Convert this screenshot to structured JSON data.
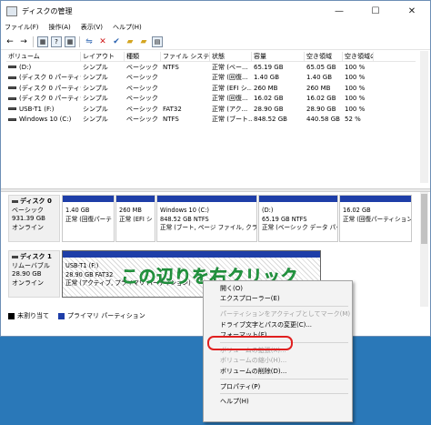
{
  "window": {
    "title": "ディスクの管理",
    "controls": {
      "minimize": "—",
      "maximize": "☐",
      "close": "✕"
    }
  },
  "menu": [
    "ファイル(F)",
    "操作(A)",
    "表示(V)",
    "ヘルプ(H)"
  ],
  "toolbar_icons": [
    "back-arrow-icon",
    "forward-arrow-icon",
    "grid-icon",
    "help-icon",
    "grid-icon-2",
    "connect-icon",
    "delete-icon",
    "check-icon",
    "folder-icon",
    "folder-icon-2",
    "properties-icon"
  ],
  "volume_table": {
    "columns": [
      "ボリューム",
      "レイアウト",
      "種類",
      "ファイル システム",
      "状態",
      "容量",
      "空き領域",
      "空き領域の割..."
    ],
    "rows": [
      [
        "(D:)",
        "シンプル",
        "ベーシック",
        "NTFS",
        "正常 (ベー...",
        "65.19 GB",
        "65.05 GB",
        "100 %"
      ],
      [
        "(ディスク 0 パーティシ...",
        "シンプル",
        "ベーシック",
        "",
        "正常 (回復...",
        "1.40 GB",
        "1.40 GB",
        "100 %"
      ],
      [
        "(ディスク 0 パーティシ...",
        "シンプル",
        "ベーシック",
        "",
        "正常 (EFI シ...",
        "260 MB",
        "260 MB",
        "100 %"
      ],
      [
        "(ディスク 0 パーティシ...",
        "シンプル",
        "ベーシック",
        "",
        "正常 (回復...",
        "16.02 GB",
        "16.02 GB",
        "100 %"
      ],
      [
        "USB-T1 (F:)",
        "シンプル",
        "ベーシック",
        "FAT32",
        "正常 (アク...",
        "28.90 GB",
        "28.90 GB",
        "100 %"
      ],
      [
        "Windows 10 (C:)",
        "シンプル",
        "ベーシック",
        "NTFS",
        "正常 (ブート...",
        "848.52 GB",
        "440.58 GB",
        "52 %"
      ]
    ]
  },
  "disks": [
    {
      "name": "ディスク 0",
      "type": "ベーシック",
      "size": "931.39 GB",
      "status": "オンライン",
      "partitions": [
        {
          "title": "",
          "line1": "1.40 GB",
          "line2": "正常 (回復パーテ"
        },
        {
          "title": "",
          "line1": "260 MB",
          "line2": "正常 (EFI シ"
        },
        {
          "title": "Windows 10  (C:)",
          "line1": "848.52 GB NTFS",
          "line2": "正常 (ブート, ページ ファイル, クラッシ"
        },
        {
          "title": "(D:)",
          "line1": "65.19 GB NTFS",
          "line2": "正常 (ベーシック データ パーテ"
        },
        {
          "title": "",
          "line1": "16.02 GB",
          "line2": "正常 (回復パーティション"
        }
      ]
    },
    {
      "name": "ディスク 1",
      "type": "リムーバブル",
      "size": "28.90 GB",
      "status": "オンライン",
      "partitions": [
        {
          "title": "USB-T1  (F:)",
          "line1": "28.90 GB FAT32",
          "line2": "正常 (アクティブ, プライマリ パーティション)"
        }
      ]
    }
  ],
  "legend": [
    {
      "label": "未割り当て",
      "color": "#000000"
    },
    {
      "label": "プライマリ パーティション",
      "color": "#1e3ea8"
    }
  ],
  "annotation": {
    "text": "この辺りを右クリック",
    "color": "#33bb55"
  },
  "context_menu": [
    {
      "label": "開く(O)",
      "enabled": true
    },
    {
      "label": "エクスプローラー(E)",
      "enabled": true
    },
    {
      "sep": true
    },
    {
      "label": "パーティションをアクティブとしてマーク(M)",
      "enabled": false
    },
    {
      "label": "ドライブ文字とパスの変更(C)...",
      "enabled": true
    },
    {
      "label": "フォーマット(F)...",
      "enabled": true,
      "highlighted": true
    },
    {
      "sep": true
    },
    {
      "label": "ボリュームの拡張(X)...",
      "enabled": false
    },
    {
      "label": "ボリュームの縮小(H)...",
      "enabled": false
    },
    {
      "label": "ボリュームの削除(D)...",
      "enabled": true
    },
    {
      "sep": true
    },
    {
      "label": "プロパティ(P)",
      "enabled": true
    },
    {
      "sep": true
    },
    {
      "label": "ヘルプ(H)",
      "enabled": true
    }
  ],
  "highlight_color": "#e02020"
}
